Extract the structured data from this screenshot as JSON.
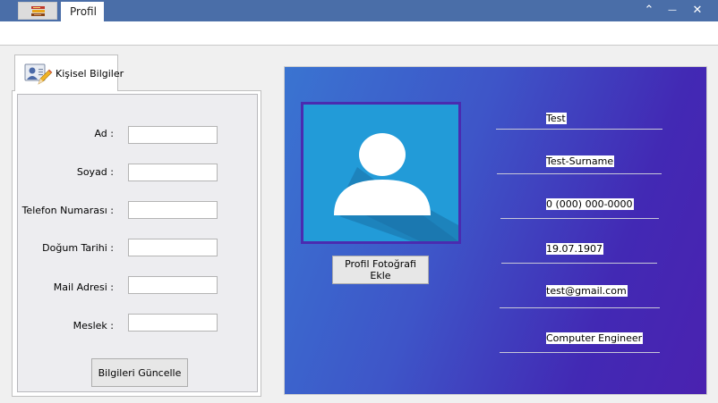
{
  "window": {
    "tab_title": "Profil",
    "controls": {
      "collapse": "⌃",
      "minimize": "—",
      "close": "✕"
    }
  },
  "tab": {
    "label": "Kişisel Bilgiler"
  },
  "form": {
    "fields": [
      {
        "label": "Ad :",
        "value": ""
      },
      {
        "label": "Soyad :",
        "value": ""
      },
      {
        "label": "Telefon Numarası :",
        "value": ""
      },
      {
        "label": "Doğum Tarihi :",
        "value": ""
      },
      {
        "label": "Mail Adresi :",
        "value": ""
      },
      {
        "label": "Meslek :",
        "value": ""
      }
    ],
    "update_button": "Bilgileri Güncelle"
  },
  "profile": {
    "add_photo_button": "Profil Fotoğrafi Ekle",
    "name": "Test",
    "surname": "Test-Surname",
    "phone": "0 (000) 000-0000",
    "birth_date": "19.07.1907",
    "email": "test@gmail.com",
    "profession": "Computer Engineer"
  },
  "colors": {
    "titlebar": "#4a6ea8",
    "card_gradient_start": "#3a74d1",
    "card_gradient_end": "#4a22b0",
    "avatar_bg": "#229bd8"
  }
}
